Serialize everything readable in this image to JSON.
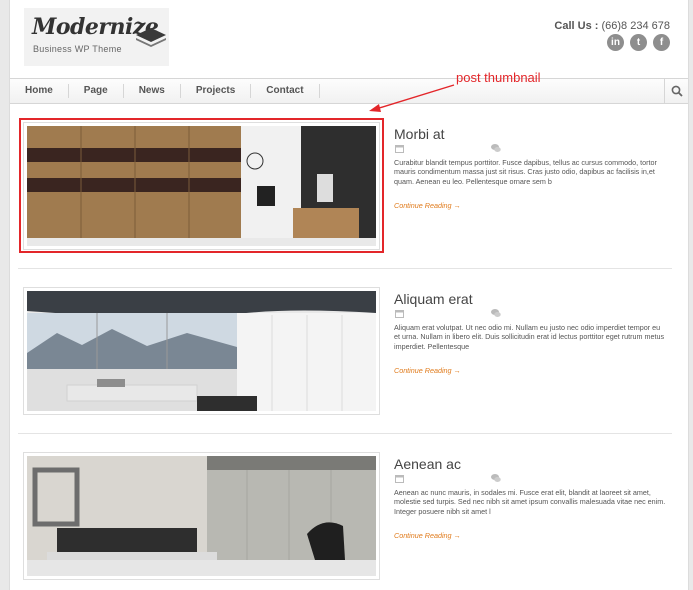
{
  "header": {
    "logo_name": "Modernize",
    "logo_tagline": "Business WP Theme",
    "call_label": "Call Us :",
    "phone": "(66)8 234 678",
    "social": [
      {
        "icon": "linkedin-icon",
        "glyph": "in"
      },
      {
        "icon": "twitter-icon",
        "glyph": "t"
      },
      {
        "icon": "facebook-icon",
        "glyph": "f"
      }
    ]
  },
  "nav": {
    "items": [
      "Home",
      "Page",
      "News",
      "Projects",
      "Contact"
    ],
    "search_icon": "search-icon"
  },
  "annotation": {
    "label": "post thumbnail",
    "color": "#e3262a"
  },
  "posts": [
    {
      "title": "Morbi at",
      "excerpt": "Curabitur blandit tempus porttitor. Fusce dapibus, tellus ac cursus commodo, tortor mauris condimentum massa just sit risus. Cras justo odio, dapibus ac facilisis in,et quam. Aenean eu leo. Pellentesque ornare sem b",
      "more": "Continue Reading →"
    },
    {
      "title": "Aliquam erat",
      "excerpt": "Aliquam erat volutpat. Ut nec odio mi. Nullam eu justo nec odio imperdiet tempor eu et urna. Nullam in libero elit. Duis sollicitudin erat id lectus porttitor eget rutrum metus imperdiet. Pellentesque",
      "more": "Continue Reading →"
    },
    {
      "title": "Aenean ac",
      "excerpt": "Aenean ac nunc mauris, in sodales mi. Fusce erat elit, blandit at laoreet sit amet, molestie sed turpis. Sed nec nibh sit amet ipsum convallis malesuada vitae nec enim. Integer posuere nibh sit amet l",
      "more": "Continue Reading →"
    }
  ],
  "colors": {
    "accent": "#e07b1c",
    "annotation": "#e3262a",
    "text": "#555555"
  }
}
